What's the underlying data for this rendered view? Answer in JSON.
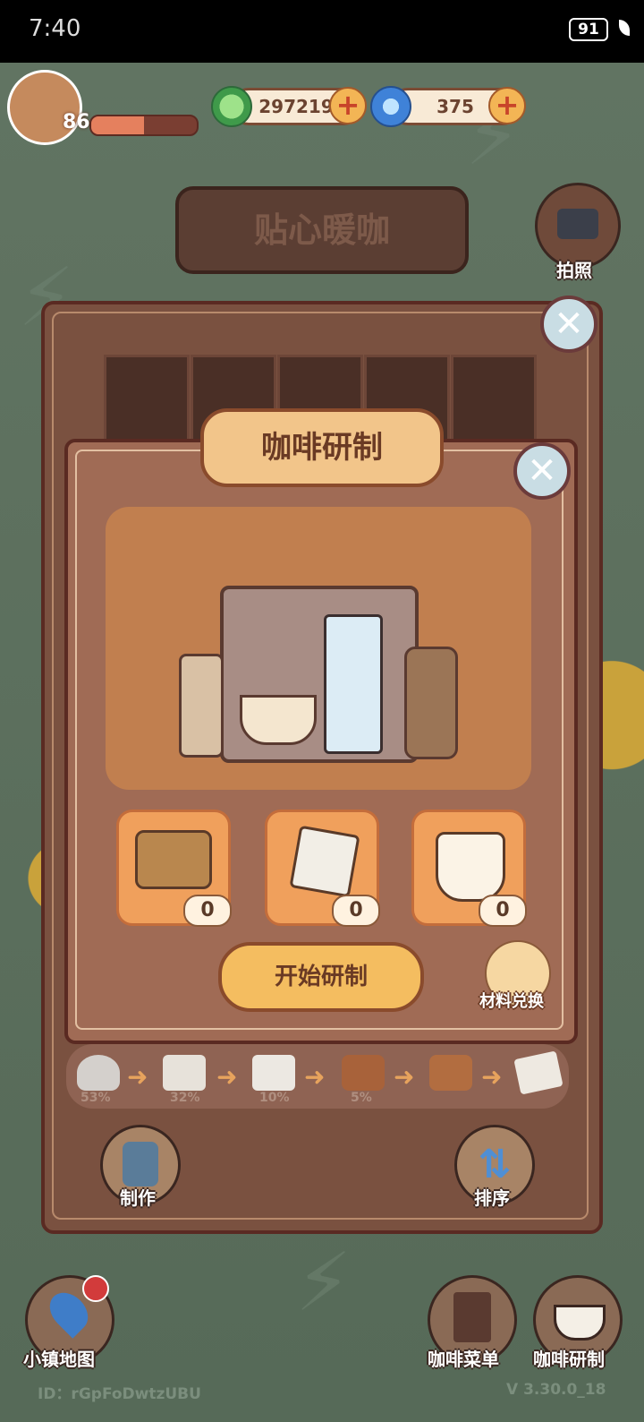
{
  "status_bar": {
    "time": "7:40",
    "battery": "91"
  },
  "player": {
    "level": "86",
    "xp_fraction": 0.5
  },
  "resources": [
    {
      "icon": "clover-coin-icon",
      "value": "297219"
    },
    {
      "icon": "swirl-gem-icon",
      "value": "375"
    }
  ],
  "shop_sign": "贴心暖咖",
  "camera": {
    "label": "拍照"
  },
  "dialog": {
    "title": "咖啡研制",
    "ingredients": [
      {
        "icon": "coffee-cups-beans-icon",
        "count": "0"
      },
      {
        "icon": "sugar-packet-icon",
        "count": "0"
      },
      {
        "icon": "milk-jug-icon",
        "count": "0"
      }
    ],
    "start_label": "开始研制",
    "exchange_label": "材料兑换"
  },
  "progress_steps": [
    {
      "icon": "powder-icon",
      "pct": "53%"
    },
    {
      "icon": "sugar-cube-plate-icon",
      "pct": "32%"
    },
    {
      "icon": "sugar-cubes-icon",
      "pct": "10%"
    },
    {
      "icon": "brown-sugar-plate-icon",
      "pct": "5%"
    },
    {
      "icon": "brown-sugar-cubes-icon",
      "pct": ""
    },
    {
      "icon": "sugar-packet-icon",
      "pct": ""
    }
  ],
  "panel_buttons": {
    "make": "制作",
    "sort": "排序"
  },
  "bottom_nav": {
    "map": "小镇地图",
    "menu": "咖啡菜单",
    "brew": "咖啡研制"
  },
  "footer": {
    "id": "ID：rGpFoDwtzUBU",
    "version": "V 3.30.0_18"
  }
}
